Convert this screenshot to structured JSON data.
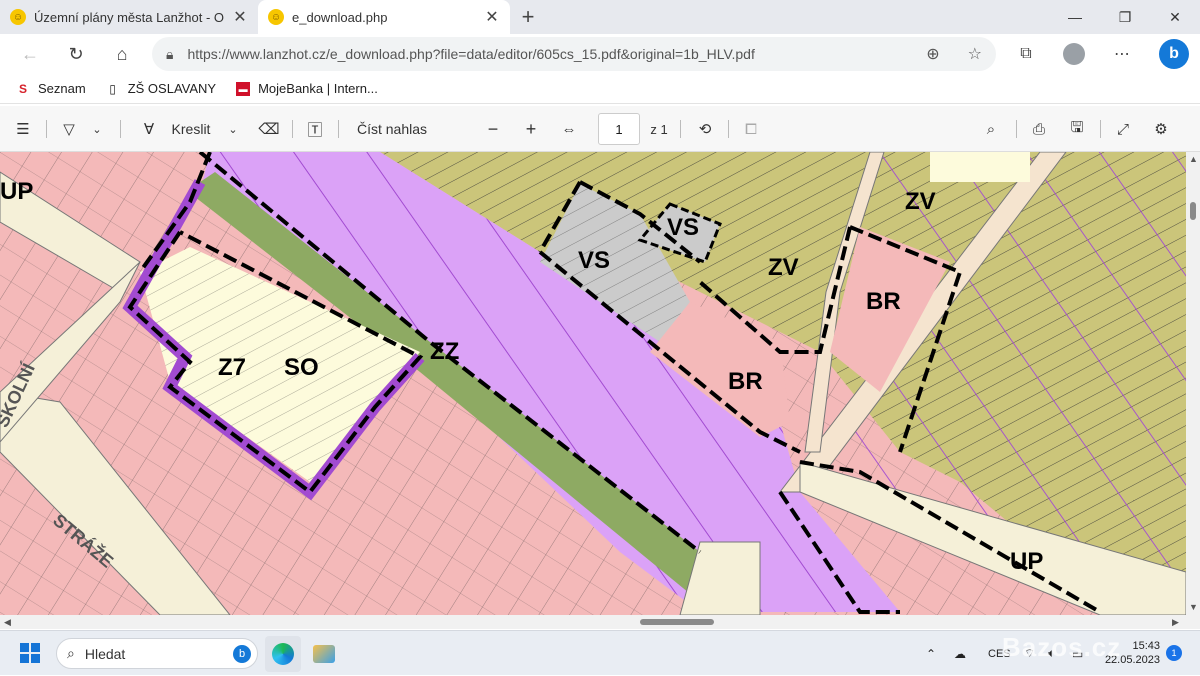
{
  "tabs": [
    {
      "title": "Územní plány města Lanžhot - O"
    },
    {
      "title": "e_download.php"
    }
  ],
  "address": {
    "url": "https://www.lanzhot.cz/e_download.php?file=data/editor/605cs_15.pdf&original=1b_HLV.pdf"
  },
  "favorites": [
    {
      "label": "Seznam"
    },
    {
      "label": "ZŠ OSLAVANY"
    },
    {
      "label": "MojeBanka | Intern..."
    }
  ],
  "pdf_toolbar": {
    "draw_label": "Kreslit",
    "read_aloud_label": "Číst nahlas",
    "page_value": "1",
    "page_total": "z 1"
  },
  "map": {
    "zone_labels": [
      "UP",
      "VS",
      "VS",
      "ZV",
      "ZV",
      "BR",
      "BR",
      "ZZ",
      "Z7",
      "SO",
      "UP"
    ],
    "street_labels": [
      "ŠKOLNÍ",
      "STRÁŽE"
    ]
  },
  "taskbar": {
    "search_placeholder": "Hledat",
    "lang": "CES",
    "time": "15:43",
    "date": "22.05.2023",
    "notifications": "1"
  },
  "watermark": "Bazos.cz",
  "colors": {
    "purple_zone": "#dba2f7",
    "pink_zone": "#f4b9b9",
    "olive_zone": "#cbc57a",
    "grey_zone": "#cbcbcb",
    "cream_zone": "#fdfbdc",
    "green_strip": "#8eaa63",
    "boundary_purple": "#a24bd1",
    "edge_accent": "#1479d8"
  }
}
